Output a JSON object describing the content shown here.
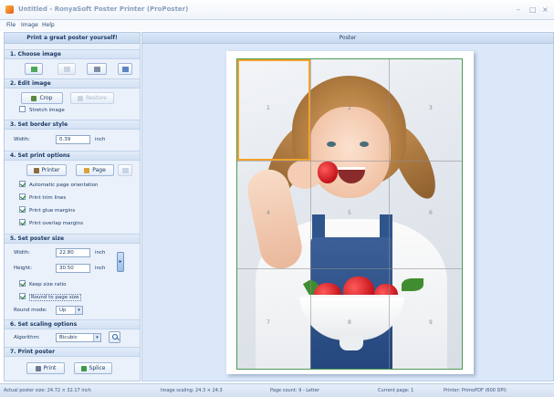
{
  "window": {
    "title": "Untitled - RonyaSoft Poster Printer (ProPoster)",
    "minimize": "–",
    "maximize": "□",
    "close": "×"
  },
  "menu": {
    "items": [
      "File",
      "Image",
      "Help"
    ]
  },
  "left_panel": {
    "header": "Print a great poster yourself!",
    "choose_image": {
      "title": "1. Choose image"
    },
    "edit_image": {
      "title": "2. Edit image",
      "crop": "Crop",
      "restore": "Restore",
      "stretch": "Stretch image"
    },
    "border": {
      "title": "3. Set border style",
      "width_label": "Width:",
      "width_value": "0.39",
      "unit": "inch"
    },
    "print_options": {
      "title": "4. Set print options",
      "printer": "Printer",
      "page": "Page",
      "auto_orient": "Automatic page orientation",
      "trim_lines": "Print trim lines",
      "glue_margins": "Print glue margins",
      "overlap_margins": "Print overlap margins"
    },
    "poster_size": {
      "title": "5. Set poster size",
      "width_label": "Width:",
      "width_value": "22.80",
      "height_label": "Height:",
      "height_value": "30.50",
      "unit": "inch",
      "keep_ratio": "Keep size ratio",
      "round": "Round to page size",
      "round_mode_label": "Round mode:",
      "round_mode_value": "Up"
    },
    "scaling": {
      "title": "6. Set scaling options",
      "algorithm_label": "Algorithm:",
      "algorithm_value": "Bicubic"
    },
    "print": {
      "title": "7. Print poster",
      "print": "Print",
      "splice": "Splice"
    }
  },
  "poster": {
    "header": "Poster",
    "page_numbers": [
      "1",
      "2",
      "3",
      "4",
      "5",
      "6",
      "7",
      "8",
      "9"
    ]
  },
  "status": {
    "poster_size": "Actual poster size: 24.72 × 32.17 inch",
    "image_scaling": "Image scaling: 24.3 × 24.3",
    "page_count": "Page count: 9 - Letter",
    "current_page": "Current page: 1",
    "printer": "Printer: PrimoPDF (600 DPI)"
  },
  "colors": {
    "accent": "#f3a22c",
    "panel": "#eaf1fb",
    "workspace": "#dbe8fa"
  }
}
